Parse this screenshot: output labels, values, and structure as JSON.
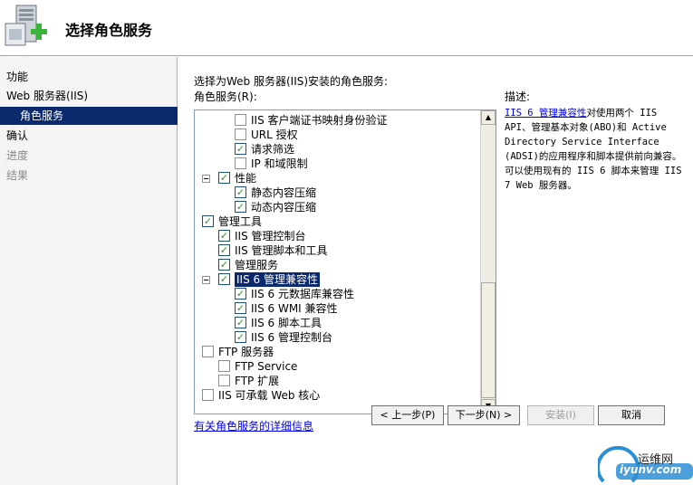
{
  "header": {
    "title": "选择角色服务"
  },
  "sidebar": {
    "items": [
      {
        "label": "功能",
        "state": "normal"
      },
      {
        "label": "Web 服务器(IIS)",
        "state": "normal"
      },
      {
        "label": "角色服务",
        "state": "active"
      },
      {
        "label": "确认",
        "state": "normal"
      },
      {
        "label": "进度",
        "state": "disabled"
      },
      {
        "label": "结果",
        "state": "disabled"
      }
    ]
  },
  "content": {
    "intro": "选择为Web 服务器(IIS)安装的角色服务:",
    "list_label": "角色服务(R):",
    "description_label": "描述:",
    "description_link": "IIS 6 管理兼容性",
    "description_text": "对使用两个 IIS API、管理基本对象(ABO)和 Active Directory Service Interface (ADSI)的应用程序和脚本提供前向兼容。可以使用现有的 IIS 6 脚本来管理 IIS 7 Web 服务器。",
    "more_info_link": "有关角色服务的详细信息"
  },
  "tree": [
    {
      "label": "IIS 客户端证书映射身份验证",
      "checked": false,
      "level": 2
    },
    {
      "label": "URL 授权",
      "checked": false,
      "level": 2
    },
    {
      "label": "请求筛选",
      "checked": true,
      "level": 2
    },
    {
      "label": "IP 和域限制",
      "checked": false,
      "level": 2
    },
    {
      "label": "性能",
      "checked": true,
      "level": 1,
      "expander": true
    },
    {
      "label": "静态内容压缩",
      "checked": true,
      "level": 2
    },
    {
      "label": "动态内容压缩",
      "checked": true,
      "level": 2
    },
    {
      "label": "管理工具",
      "checked": true,
      "level": 0,
      "expander": true
    },
    {
      "label": "IIS 管理控制台",
      "checked": true,
      "level": 1
    },
    {
      "label": "IIS 管理脚本和工具",
      "checked": true,
      "level": 1
    },
    {
      "label": "管理服务",
      "checked": true,
      "level": 1
    },
    {
      "label": "IIS 6 管理兼容性",
      "checked": true,
      "level": 1,
      "expander": true,
      "selected": true
    },
    {
      "label": "IIS 6 元数据库兼容性",
      "checked": true,
      "level": 2
    },
    {
      "label": "IIS 6 WMI 兼容性",
      "checked": true,
      "level": 2
    },
    {
      "label": "IIS 6 脚本工具",
      "checked": true,
      "level": 2
    },
    {
      "label": "IIS 6 管理控制台",
      "checked": true,
      "level": 2
    },
    {
      "label": "FTP 服务器",
      "checked": false,
      "level": 0,
      "expander": true
    },
    {
      "label": "FTP Service",
      "checked": false,
      "level": 1
    },
    {
      "label": "FTP 扩展",
      "checked": false,
      "level": 1
    },
    {
      "label": "IIS 可承载 Web 核心",
      "checked": false,
      "level": 0
    }
  ],
  "buttons": {
    "prev": "< 上一步(P)",
    "next": "下一步(N) >",
    "install": "安装(I)",
    "cancel": "取消"
  },
  "watermark": {
    "line1": "运维网",
    "line2": "iyunv.com"
  }
}
